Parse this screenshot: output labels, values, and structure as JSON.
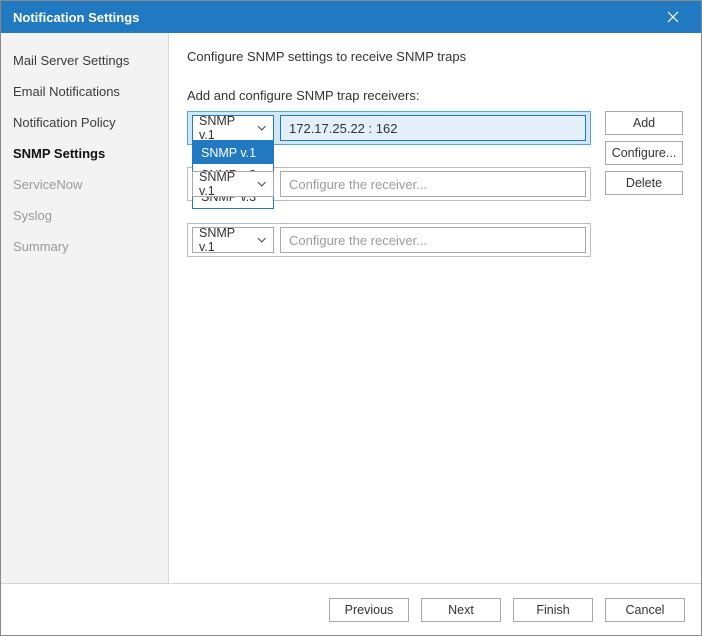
{
  "window": {
    "title": "Notification Settings"
  },
  "sidebar": {
    "items": [
      {
        "label": "Mail Server Settings",
        "active": false,
        "muted": false
      },
      {
        "label": "Email Notifications",
        "active": false,
        "muted": false
      },
      {
        "label": "Notification Policy",
        "active": false,
        "muted": false
      },
      {
        "label": "SNMP Settings",
        "active": true,
        "muted": false
      },
      {
        "label": "ServiceNow",
        "active": false,
        "muted": true
      },
      {
        "label": "Syslog",
        "active": false,
        "muted": true
      },
      {
        "label": "Summary",
        "active": false,
        "muted": true
      }
    ]
  },
  "main": {
    "heading": "Configure SNMP settings to receive SNMP traps",
    "section_label": "Add and configure SNMP trap receivers:",
    "placeholder": "Configure the receiver...",
    "receivers": [
      {
        "version": "SNMP v.1",
        "value": "172.17.25.22 : 162",
        "selected": true,
        "dropdown_open": true
      },
      {
        "version": "SNMP v.1",
        "value": "",
        "selected": false,
        "dropdown_open": false
      },
      {
        "version": "SNMP v.1",
        "value": "",
        "selected": false,
        "dropdown_open": false
      }
    ],
    "version_options": [
      "SNMP v.1",
      "SNMP v.2",
      "SNMP v.3"
    ],
    "buttons": {
      "add": "Add",
      "configure": "Configure...",
      "delete": "Delete"
    }
  },
  "footer": {
    "previous": "Previous",
    "next": "Next",
    "finish": "Finish",
    "cancel": "Cancel"
  }
}
